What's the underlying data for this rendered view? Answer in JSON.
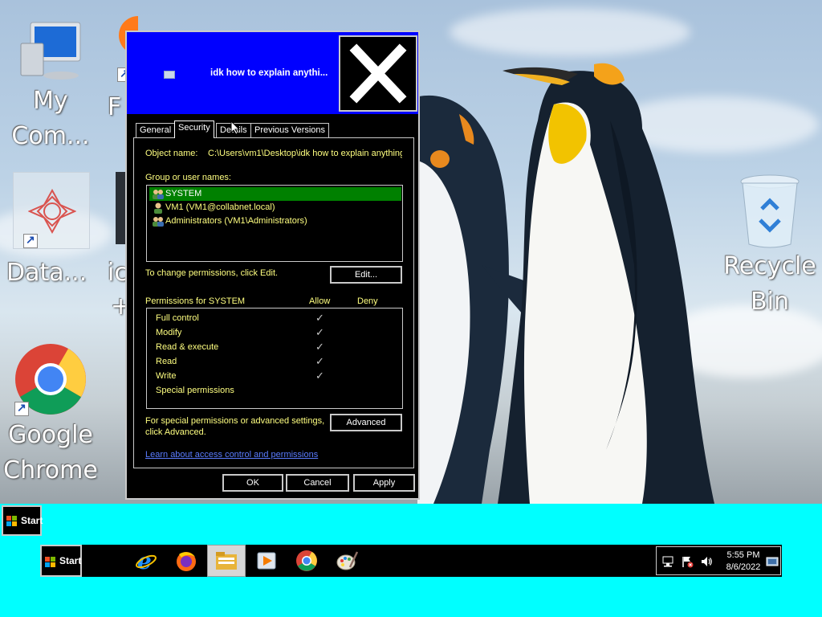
{
  "desktop": {
    "icons": [
      {
        "label_1": "My",
        "label_2": "Com...",
        "icon": "computer-icon"
      },
      {
        "label_1": "F",
        "icon": "firefox-icon"
      },
      {
        "label_1": "Data...",
        "icon": "data-app-icon"
      },
      {
        "label_1": "ic",
        "label_2": "+",
        "icon": "partial-icon"
      },
      {
        "label_1": "Google",
        "label_2": "Chrome",
        "icon": "chrome-icon"
      },
      {
        "label_1": "Recycle",
        "label_2": "Bin",
        "icon": "recycle-bin-icon"
      }
    ]
  },
  "dialog": {
    "title": "idk how to explain anythi...",
    "tabs": [
      "General",
      "Security",
      "Details",
      "Previous Versions"
    ],
    "object_name_label": "Object name:",
    "object_name_value": "C:\\Users\\vm1\\Desktop\\idk how to explain anything",
    "group_label": "Group or user names:",
    "users": [
      {
        "name": "SYSTEM",
        "selected": true
      },
      {
        "name": "VM1 (VM1@collabnet.local)",
        "selected": false
      },
      {
        "name": "Administrators (VM1\\Administrators)",
        "selected": false
      }
    ],
    "change_text": "To change permissions, click Edit.",
    "edit_label": "Edit...",
    "perm_header": "Permissions for SYSTEM",
    "allow_label": "Allow",
    "deny_label": "Deny",
    "permissions": [
      {
        "name": "Full control",
        "allow": "✓"
      },
      {
        "name": "Modify",
        "allow": "✓"
      },
      {
        "name": "Read & execute",
        "allow": "✓"
      },
      {
        "name": "Read",
        "allow": "✓"
      },
      {
        "name": "Write",
        "allow": "✓"
      },
      {
        "name": "Special permissions",
        "allow": ""
      }
    ],
    "special_text_1": "For special permissions or advanced settings,",
    "special_text_2": "click Advanced.",
    "advanced_label": "Advanced",
    "link_text": "Learn about access control and permissions",
    "ok_label": "OK",
    "cancel_label": "Cancel",
    "apply_label": "Apply"
  },
  "taskbar": {
    "start_top_label": "Start",
    "start_label": "Start",
    "pinned": [
      "ie-icon",
      "firefox-icon",
      "file-explorer-icon",
      "media-player-icon",
      "chrome-icon",
      "paint-icon"
    ],
    "clock_time": "5:55 PM",
    "clock_date": "8/6/2022"
  },
  "colors": {
    "title_bar": "#0000ff",
    "selected_row": "#008000",
    "text_yellow": "#ffff80",
    "taskbar_area": "#00ffff"
  }
}
